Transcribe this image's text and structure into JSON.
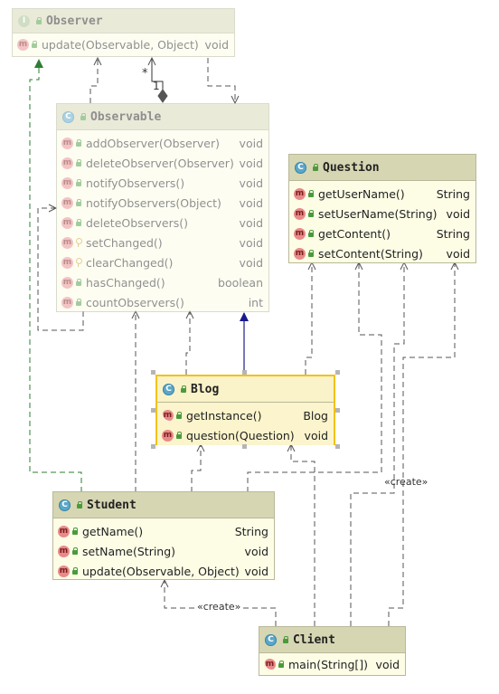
{
  "classes": {
    "observer": {
      "kind": "I",
      "name": "Observer",
      "methods": [
        {
          "name": "update(Observable, Object)",
          "ret": "void"
        }
      ]
    },
    "observable": {
      "kind": "C",
      "name": "Observable",
      "methods": [
        {
          "name": "addObserver(Observer)",
          "ret": "void"
        },
        {
          "name": "deleteObserver(Observer)",
          "ret": "void"
        },
        {
          "name": "notifyObservers()",
          "ret": "void"
        },
        {
          "name": "notifyObservers(Object)",
          "ret": "void"
        },
        {
          "name": "deleteObservers()",
          "ret": "void"
        },
        {
          "name": "setChanged()",
          "ret": "void"
        },
        {
          "name": "clearChanged()",
          "ret": "void"
        },
        {
          "name": "hasChanged()",
          "ret": "boolean"
        },
        {
          "name": "countObservers()",
          "ret": "int"
        }
      ]
    },
    "question": {
      "kind": "C",
      "name": "Question",
      "methods": [
        {
          "name": "getUserName()",
          "ret": "String"
        },
        {
          "name": "setUserName(String)",
          "ret": "void"
        },
        {
          "name": "getContent()",
          "ret": "String"
        },
        {
          "name": "setContent(String)",
          "ret": "void"
        }
      ]
    },
    "blog": {
      "kind": "C",
      "name": "Blog",
      "methods": [
        {
          "name": "getInstance()",
          "ret": "Blog"
        },
        {
          "name": "question(Question)",
          "ret": "void"
        }
      ]
    },
    "student": {
      "kind": "C",
      "name": "Student",
      "methods": [
        {
          "name": "getName()",
          "ret": "String"
        },
        {
          "name": "setName(String)",
          "ret": "void"
        },
        {
          "name": "update(Observable, Object)",
          "ret": "void"
        }
      ]
    },
    "client": {
      "kind": "C",
      "name": "Client",
      "methods": [
        {
          "name": "main(String[])",
          "ret": "void"
        }
      ]
    }
  },
  "labels": {
    "multiplicity_many": "*",
    "multiplicity_one": "1",
    "create_1": "«create»",
    "create_2": "«create»"
  },
  "colors": {
    "dependency": "#555555",
    "realization": "#2e7d32",
    "inheritance": "#1a1a8c",
    "class_body": "#fdfde6",
    "class_header": "#d6d6b3",
    "selection": "#f1c21b"
  }
}
